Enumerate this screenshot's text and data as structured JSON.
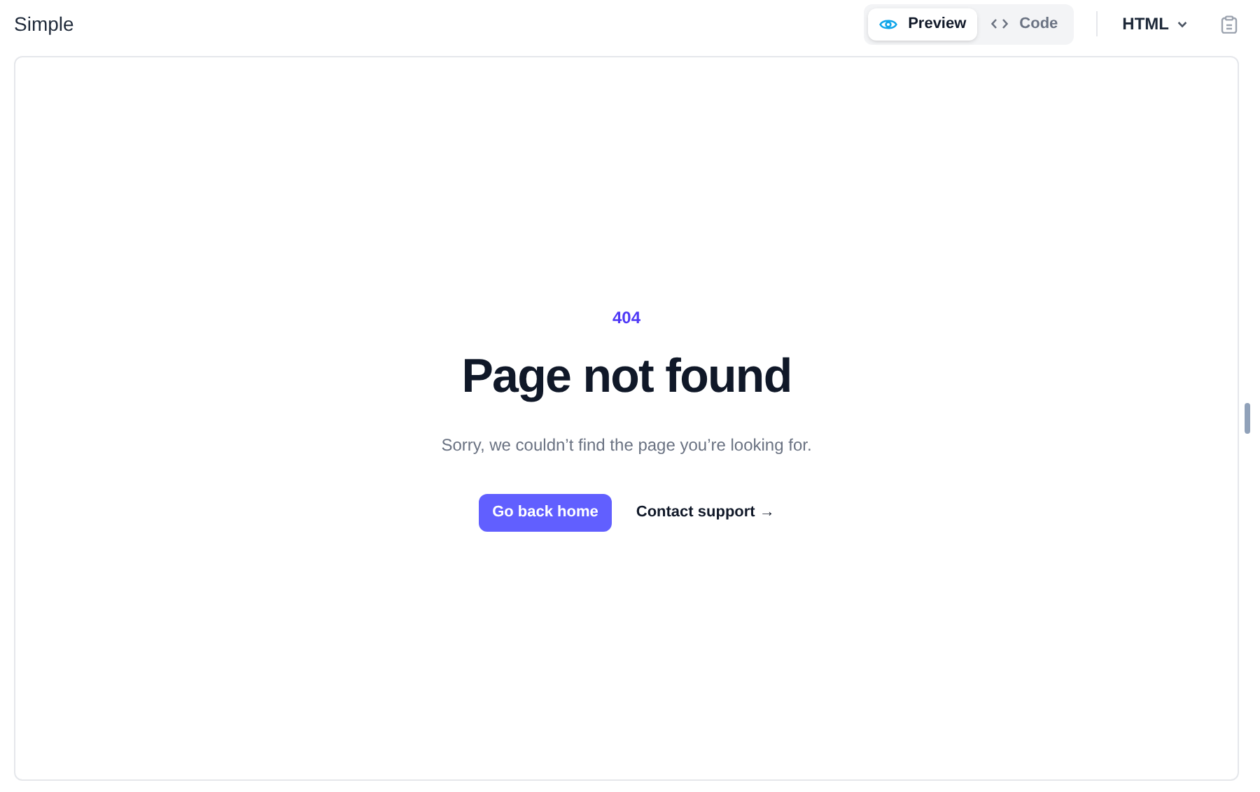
{
  "title": "Simple",
  "view_tabs": [
    {
      "label": "Preview",
      "kind": "eye",
      "selected": true
    },
    {
      "label": "Code",
      "kind": "code",
      "selected": false
    }
  ],
  "language": {
    "label": "HTML"
  },
  "preview": {
    "code": "404",
    "heading": "Page not found",
    "message": "Sorry, we couldn’t find the page you’re looking for.",
    "primary_button": "Go back home",
    "link": "Contact support →"
  }
}
